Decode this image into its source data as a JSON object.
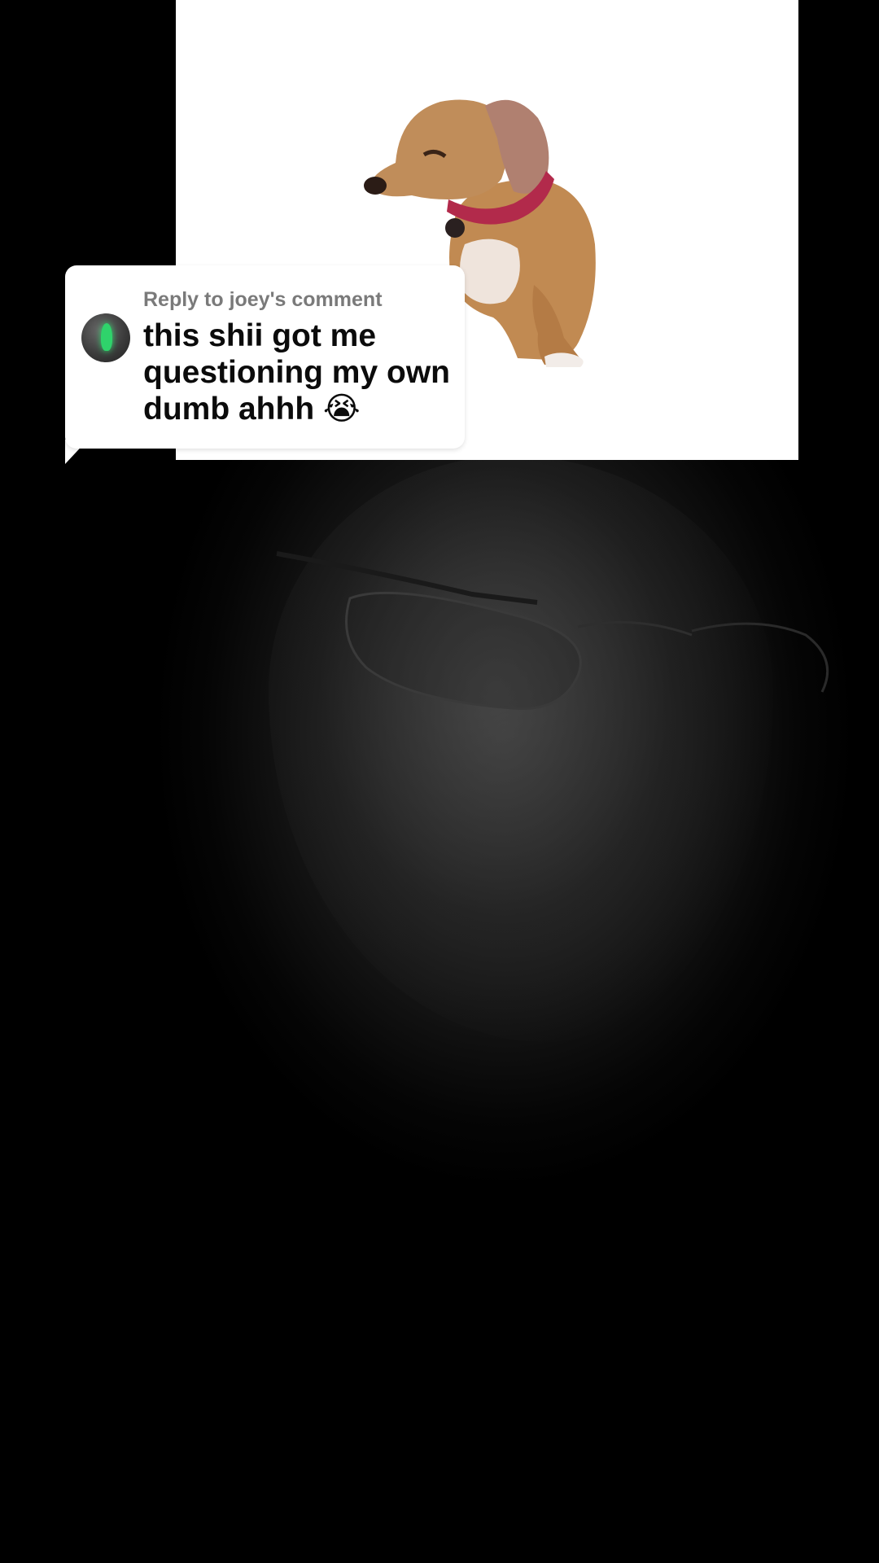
{
  "reply_card": {
    "header": "Reply to joey's comment",
    "comment": "this shii got me questioning my own dumb ahhh 😭",
    "avatar_icon": "avatar-icon"
  },
  "colors": {
    "background": "#000000",
    "card": "#ffffff",
    "reply_header": "#7a7a7a",
    "comment_text": "#0b0b0b",
    "avatar_accent": "#2fd36b"
  }
}
